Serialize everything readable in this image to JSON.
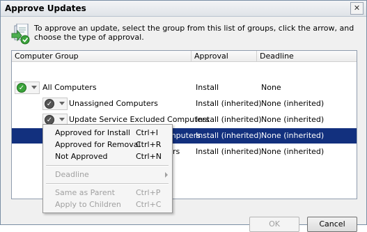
{
  "window": {
    "title": "Approve Updates",
    "close_glyph": "✕"
  },
  "instructions": "To approve an update, select the group from this list of groups, click the arrow, and choose the type of approval.",
  "columns": {
    "group": "Computer Group",
    "approval": "Approval",
    "deadline": "Deadline"
  },
  "rows": [
    {
      "name": "All Computers",
      "approval": "Install",
      "deadline": "None",
      "icon": "approved-check-icon"
    },
    {
      "name": "Unassigned Computers",
      "approval": "Install (inherited)",
      "deadline": "None (inherited)",
      "icon": "inherited-check-icon"
    },
    {
      "name": "Update Service Excluded Computers",
      "approval": "Install (inherited)",
      "deadline": "None (inherited)",
      "icon": "inherited-check-icon"
    },
    {
      "name": "Update Services Client Computers",
      "approval": "Install (inherited)",
      "deadline": "None (inherited)",
      "icon": "inherited-check-icon",
      "selected": true
    },
    {
      "name": "rs",
      "approval": "Install (inherited)",
      "deadline": "None (inherited)"
    }
  ],
  "menu": {
    "items": [
      {
        "label": "Approved for Install",
        "shortcut": "Ctrl+I"
      },
      {
        "label": "Approved for Removal",
        "shortcut": "Ctrl+R"
      },
      {
        "label": "Not Approved",
        "shortcut": "Ctrl+N"
      },
      {
        "label": "Deadline",
        "shortcut": ""
      },
      {
        "label": "Same as Parent",
        "shortcut": "Ctrl+P"
      },
      {
        "label": "Apply to Children",
        "shortcut": "Ctrl+C"
      }
    ]
  },
  "buttons": {
    "ok": "OK",
    "cancel": "Cancel"
  },
  "colors": {
    "selection": "#12307e",
    "approved": "#3aa33a"
  }
}
